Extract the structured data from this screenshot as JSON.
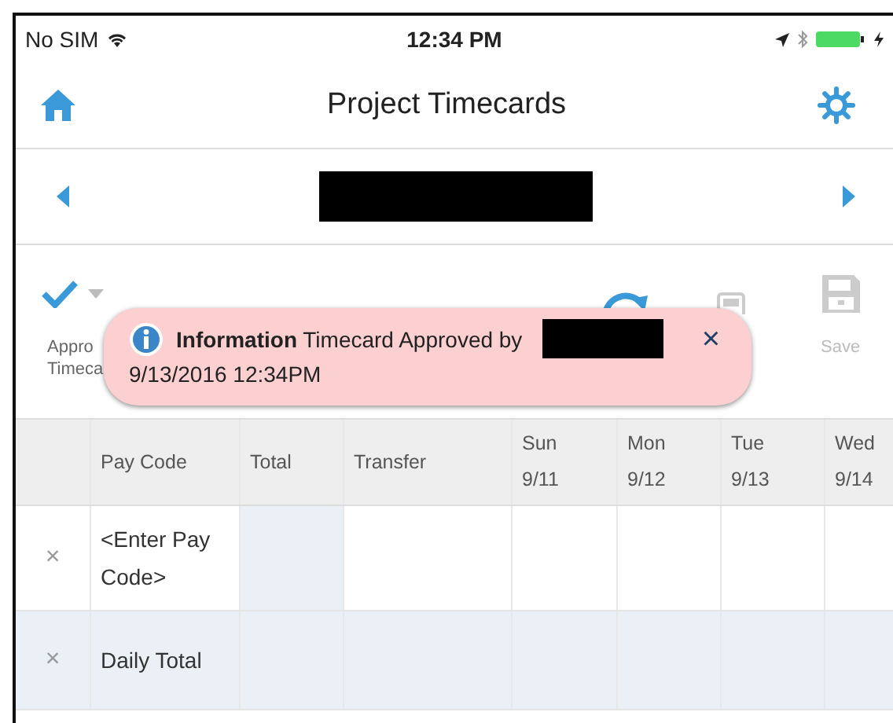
{
  "status_bar": {
    "carrier": "No SIM",
    "time": "12:34 PM"
  },
  "nav": {
    "title": "Project Timecards"
  },
  "toolbar": [
    {
      "kind": "approve",
      "label_lines": [
        "Appro",
        "Timeca"
      ],
      "disabled": false
    },
    {
      "kind": "refresh",
      "disabled": false
    },
    {
      "kind": "calculate",
      "disabled": true
    },
    {
      "kind": "save",
      "label_lines": [
        "Save"
      ],
      "disabled": true
    }
  ],
  "toast": {
    "message": "**Information** Timecard Approved by",
    "timestamp": "9/13/2016 12:34PM",
    "close": "×"
  },
  "table": {
    "columns": [
      {
        "lines": [
          "Pay Code"
        ]
      },
      {
        "lines": [
          "Total"
        ]
      },
      {
        "lines": [
          "Transfer"
        ]
      },
      {
        "lines": [
          "Sun",
          "9/11"
        ]
      },
      {
        "lines": [
          "Mon",
          "9/12"
        ]
      },
      {
        "lines": [
          "Tue",
          "9/13"
        ]
      },
      {
        "lines": [
          "Wed",
          "9/14"
        ]
      }
    ],
    "rows": [
      {
        "kind": "entry",
        "pay_code": "<Enter Pay Code>",
        "remove": "×"
      },
      {
        "kind": "total",
        "pay_code": "Daily Total",
        "remove": "×"
      }
    ]
  }
}
